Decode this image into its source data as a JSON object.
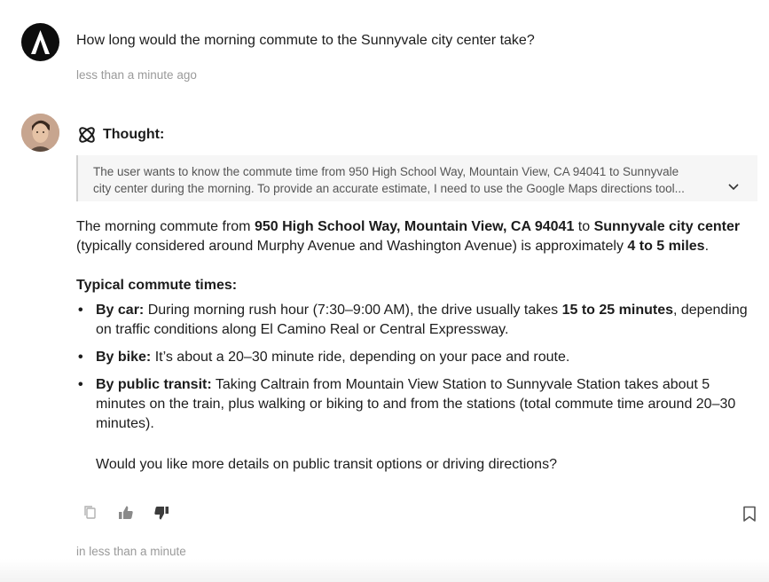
{
  "conversation": {
    "user_message": {
      "text": "How long would the morning commute to the Sunnyvale city center take?",
      "timestamp": "less than a minute ago"
    },
    "assistant_message": {
      "thought": {
        "label": "Thought:",
        "line1": "The user wants to know the commute time from 950 High School Way, Mountain View, CA 94041 to Sunnyvale",
        "line2": "city center during the morning. To provide an accurate estimate, I need to use the Google Maps directions tool..."
      },
      "intro": {
        "p1": "The morning commute from ",
        "b1": "950 High School Way, Mountain View, CA 94041",
        "p2": " to ",
        "b2": "Sunnyvale city center",
        "p3": " (typically considered around Murphy Avenue and Washington Avenue) is approximately ",
        "b3": "4 to 5 miles",
        "p4": "."
      },
      "section_title": "Typical commute times:",
      "items": [
        {
          "label": "By car:",
          "text1": " During morning rush hour (7:30–9:00 AM), the drive usually takes ",
          "bold": "15 to 25 minutes",
          "text2": ", depending on traffic conditions along El Camino Real or Central Expressway."
        },
        {
          "label": "By bike:",
          "text1": " It’s about a 20–30 minute ride, depending on your pace and route."
        },
        {
          "label": "By public transit:",
          "text1": " Taking Caltrain from Mountain View Station to Sunnyvale Station takes about 5 minutes on the train, plus walking or biking to and from the stations (total commute time around 20–30 minutes)."
        }
      ],
      "closing": "Would you like more details on public transit options or driving directions?",
      "timestamp": "in less than a minute"
    }
  },
  "icons": {
    "user_avatar": "app-logo-icon",
    "assistant_avatar": "assistant-avatar",
    "thought": "thought-atom-icon",
    "expand": "chevron-down-icon",
    "copy": "copy-icon",
    "like": "thumbs-up-icon",
    "dislike": "thumbs-down-icon",
    "bookmark": "bookmark-icon"
  },
  "colors": {
    "text": "#1c1c1c",
    "muted": "#9a9a9a",
    "thought_bg": "#f6f6f6",
    "thought_border": "#d0d0d0"
  }
}
